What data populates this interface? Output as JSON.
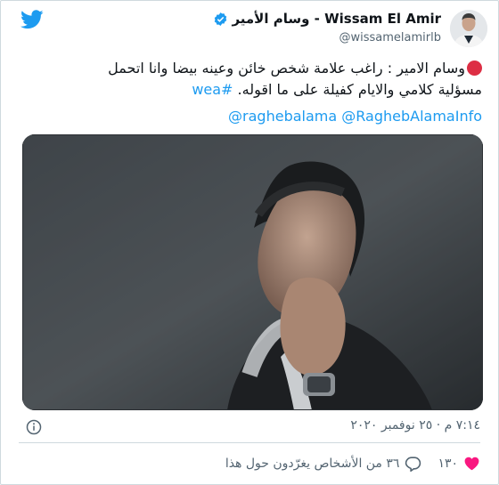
{
  "colors": {
    "twitter_blue": "#1d9bf0",
    "text_primary": "#0f1419",
    "text_secondary": "#536471",
    "heart_red": "#f91880",
    "border": "#cfd9de"
  },
  "header": {
    "display_name": "وسام الأمير - Wissam El Amir",
    "handle": "@wissamelamirlb",
    "logo_icon": "twitter-bird-icon",
    "verified_icon": "verified-badge-icon"
  },
  "tweet": {
    "emoji": "red-circle-icon",
    "text_line1": "وسام الامير : راغب علامة شخص خائن وعينه بيضا وانا اتحمل",
    "text_line2": "مسؤلية كلامي والايام كفيلة على ما اقوله.",
    "hashtag": "#wea",
    "mention1": "@RaghebAlamaInfo",
    "mention2": "@raghebalama"
  },
  "media": {
    "description_icon": "video-still-image"
  },
  "meta": {
    "timestamp": "٧:١٤ م · ٢٥ نوفمبر ٢٠٢٠",
    "info_icon": "info-icon"
  },
  "actions": {
    "likes": "١٣٠",
    "replies": "٣٦ من الأشخاص يغرّدون حول هذا"
  }
}
